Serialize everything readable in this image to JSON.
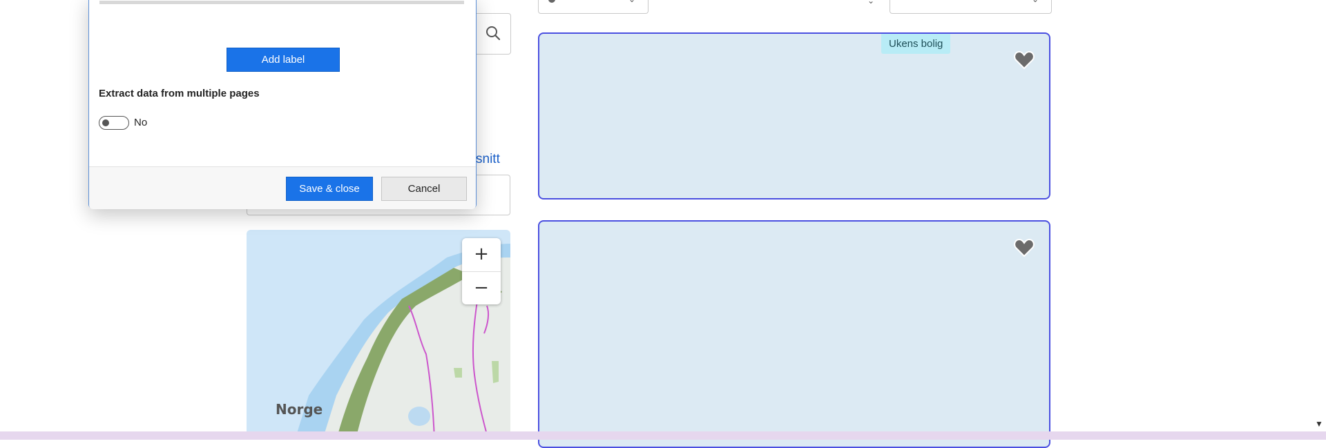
{
  "dialog": {
    "add_label_button": "Add label",
    "extract_label": "Extract data from multiple pages",
    "toggle_state_text": "No",
    "save_button": "Save & close",
    "cancel_button": "Cancel"
  },
  "page": {
    "utsnitt_link": "Utsnitt",
    "map_country_label": "Norge",
    "zoom_in": "+",
    "zoom_out": "−",
    "listings": [
      {
        "badge": "Ukens bolig"
      }
    ]
  },
  "icons": [
    "search-icon",
    "heart-icon",
    "location-pin-icon",
    "chevron-down-icon"
  ],
  "colors": {
    "primary_button": "#1a73e8",
    "card_border": "#4a4fe0",
    "card_background": "#dceaf3",
    "badge_background": "#b8ecf6",
    "link": "#1a5fc8"
  }
}
